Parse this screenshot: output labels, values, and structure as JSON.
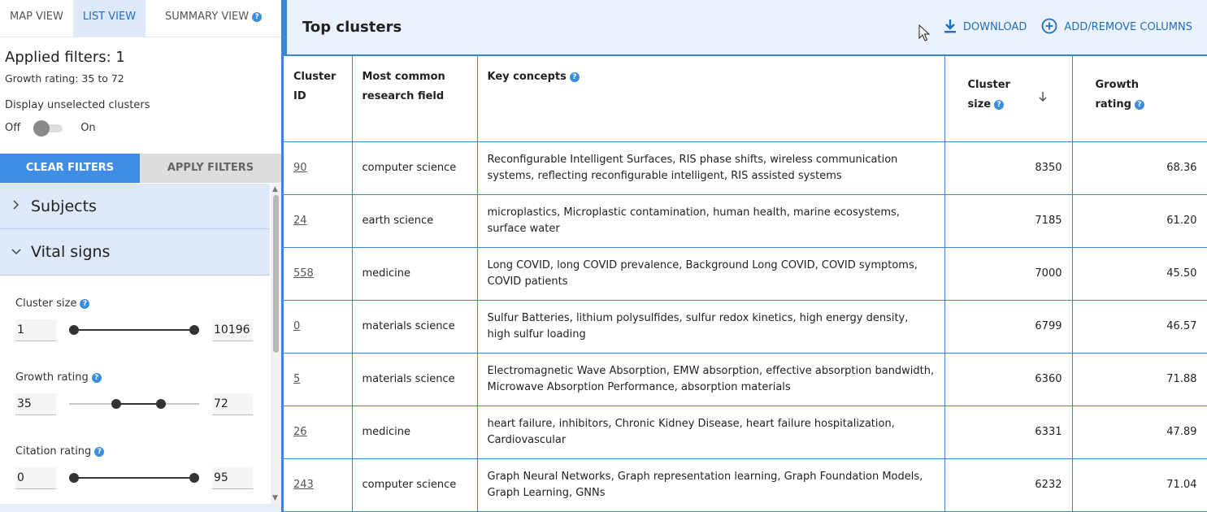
{
  "tabs": [
    {
      "label": "MAP VIEW",
      "active": false
    },
    {
      "label": "LIST VIEW",
      "active": true
    },
    {
      "label": "SUMMARY VIEW",
      "active": false
    }
  ],
  "filters": {
    "applied_title": "Applied filters: 1",
    "applied_detail": "Growth rating: 35 to 72",
    "display_unselected_label": "Display unselected clusters",
    "toggle_off_label": "Off",
    "toggle_on_label": "On",
    "toggle_on": false,
    "clear_label": "CLEAR FILTERS",
    "apply_label": "APPLY FILTERS"
  },
  "accordion": [
    {
      "label": "Subjects",
      "expanded": false
    },
    {
      "label": "Vital signs",
      "expanded": true
    }
  ],
  "sliders": [
    {
      "label": "Cluster size",
      "min_value": "1",
      "max_value": "10196",
      "range": [
        1,
        10196
      ],
      "low": 1,
      "high": 10196
    },
    {
      "label": "Growth rating",
      "min_value": "35",
      "max_value": "72",
      "range": [
        0,
        100
      ],
      "low": 35,
      "high": 72
    },
    {
      "label": "Citation rating",
      "min_value": "0",
      "max_value": "95",
      "range": [
        0,
        95
      ],
      "low": 0,
      "high": 95
    }
  ],
  "main": {
    "title": "Top clusters",
    "download_label": "DOWNLOAD",
    "columns_label": "ADD/REMOVE COLUMNS",
    "accent_color": "#3a86d6"
  },
  "table": {
    "headers": {
      "cluster_id_1": "Cluster",
      "cluster_id_2": "ID",
      "field_1": "Most common",
      "field_2": "research field",
      "concepts": "Key concepts",
      "size_1": "Cluster",
      "size_2": "size",
      "growth_1": "Growth",
      "growth_2": "rating"
    },
    "rows": [
      {
        "id": "90",
        "field": "computer science",
        "concepts": "Reconfigurable Intelligent Surfaces, RIS phase shifts, wireless communication systems, reflecting reconfigurable intelligent, RIS assisted systems",
        "size": "8350",
        "growth": "68.36"
      },
      {
        "id": "24",
        "field": "earth science",
        "concepts": "microplastics, Microplastic contamination, human health, marine ecosystems, surface water",
        "size": "7185",
        "growth": "61.20"
      },
      {
        "id": "558",
        "field": "medicine",
        "concepts": "Long COVID, long COVID prevalence, Background Long COVID, COVID symptoms, COVID patients",
        "size": "7000",
        "growth": "45.50"
      },
      {
        "id": "0",
        "field": "materials science",
        "concepts": "Sulfur Batteries, lithium polysulfides, sulfur redox kinetics, high energy density, high sulfur loading",
        "size": "6799",
        "growth": "46.57"
      },
      {
        "id": "5",
        "field": "materials science",
        "concepts": "Electromagnetic Wave Absorption, EMW absorption, effective absorption bandwidth, Microwave Absorption Performance, absorption materials",
        "size": "6360",
        "growth": "71.88"
      },
      {
        "id": "26",
        "field": "medicine",
        "concepts": "heart failure, inhibitors, Chronic Kidney Disease, heart failure hospitalization, Cardiovascular",
        "size": "6331",
        "growth": "47.89"
      },
      {
        "id": "243",
        "field": "computer science",
        "concepts": "Graph Neural Networks, Graph representation learning, Graph Foundation Models, Graph Learning, GNNs",
        "size": "6232",
        "growth": "71.04"
      }
    ]
  }
}
